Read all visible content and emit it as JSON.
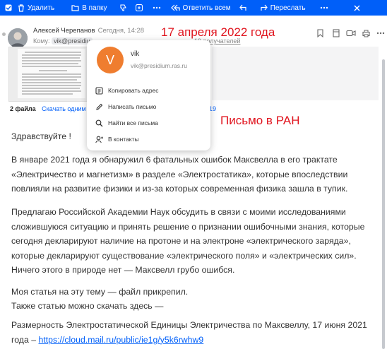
{
  "toolbar": {
    "delete": "Удалить",
    "to_folder": "В папку",
    "reply_all": "Ответить всем",
    "forward": "Переслать",
    "color": "#005ff9"
  },
  "message": {
    "sender": "Алексей Черепанов",
    "date": "Сегодня, 14:28",
    "to_label": "Кому:",
    "to_chip": "vik@presidiu",
    "recipients_link": "19 получателей",
    "files_count": "2 файла",
    "download_link": "Скачать одним",
    "files_link_tail": "19"
  },
  "annotations": {
    "date_note": "17 апреля 2022 года",
    "ran_note": "Письмо в РАН",
    "color": "#e0141e"
  },
  "popup": {
    "avatar_letter": "V",
    "name": "vik",
    "email": "vik@presidium.ras.ru",
    "items": [
      "Копировать адрес",
      "Написать письмо",
      "Найти все письма",
      "В контакты"
    ]
  },
  "body": {
    "greeting": "Здравствуйте !",
    "p1": "В январе 2021 года я обнаружил 6 фатальных ошибок Максвелла в его трактате «Электричество и магнетизм» в разделе «Электростатика», которые впоследствии повлияли на развитие физики и из-за которых современная физика зашла в тупик.",
    "p2": "Предлагаю Российской Академии Наук обсудить в связи с моими исследованиями сложившуюся ситуацию и принять решение о признании ошибочными знания, которые сегодня декларируют наличие на протоне и на электроне «электрического заряда», которые декларируют существование «электрического поля» и «электрических сил». Ничего этого в природе нет — Максвелл грубо ошибся.",
    "p3a": "Моя статья на эту тему — файл прикрепил.",
    "p3b": "Также статью можно скачать здесь —",
    "p4": "Размерность Электростатической Единицы Электричества по Максвеллу, 17 июня 2021 года –",
    "link": "https://cloud.mail.ru/public/ie1g/y5k6rwhw9"
  }
}
